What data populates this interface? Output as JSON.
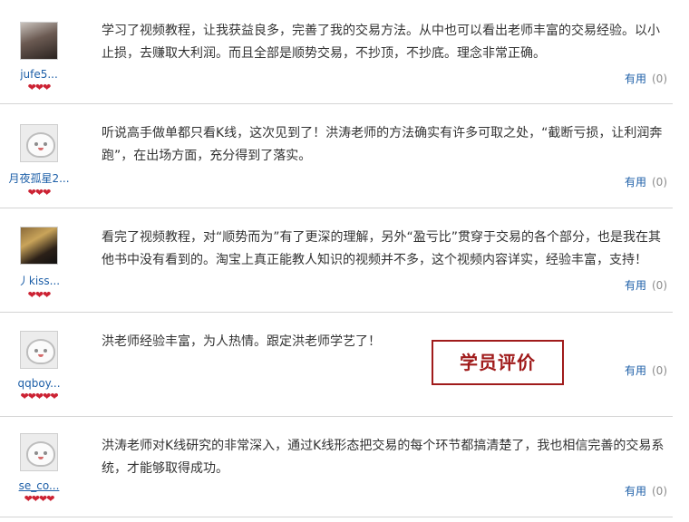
{
  "reviews": [
    {
      "username": "jufe5...",
      "hearts": "❤❤❤",
      "text": "学习了视频教程，让我获益良多，完善了我的交易方法。从中也可以看出老师丰富的交易经验。以小止损，去赚取大利润。而且全部是顺势交易，不抄顶，不抄底。理念非常正确。",
      "helpful_label": "有用",
      "helpful_count": "(0)"
    },
    {
      "username": "月夜孤星2...",
      "hearts": "❤❤❤",
      "text": "听说高手做单都只看K线，这次见到了！洪涛老师的方法确实有许多可取之处，“截断亏损，让利润奔跑”，在出场方面，充分得到了落实。",
      "helpful_label": "有用",
      "helpful_count": "(0)"
    },
    {
      "username": "丿kiss...",
      "hearts": "❤❤❤",
      "text": "看完了视频教程，对“顺势而为”有了更深的理解，另外“盈亏比”贯穿于交易的各个部分，也是我在其他书中没有看到的。淘宝上真正能教人知识的视频并不多，这个视频内容详实，经验丰富，支持！",
      "helpful_label": "有用",
      "helpful_count": "(0)"
    },
    {
      "username": "qqboy...",
      "hearts": "❤❤❤❤❤",
      "text": "洪老师经验丰富，为人热情。跟定洪老师学艺了！",
      "helpful_label": "有用",
      "helpful_count": "(0)"
    },
    {
      "username": "se_co...",
      "hearts": "❤❤❤❤",
      "text": "洪涛老师对K线研究的非常深入，通过K线形态把交易的每个环节都搞清楚了，我也相信完善的交易系统，才能够取得成功。",
      "helpful_label": "有用",
      "helpful_count": "(0)"
    }
  ],
  "stamp": "学员评价"
}
